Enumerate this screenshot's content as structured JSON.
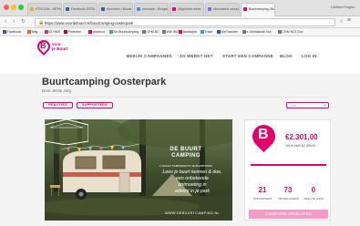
{
  "browser": {
    "tabs": [
      {
        "label": "STROOM - NETW"
      },
      {
        "label": "Facebook ZRTO"
      },
      {
        "label": "Berichten | Brows"
      },
      {
        "label": "armuade - Boogaa"
      },
      {
        "label": "Uitgelichte deze"
      },
      {
        "label": "Nieuwsbrie campa"
      },
      {
        "label": "Buurtcamping, Du"
      }
    ],
    "profile": "Untitled Pages",
    "url": "https://www.voordebuurt.nl/buurtcamping-oosterpark",
    "bookmarks": [
      {
        "label": "Facebook"
      },
      {
        "label": "Bitly"
      },
      {
        "label": "IG HMS"
      },
      {
        "label": "Pinterest"
      },
      {
        "label": "voorinvo"
      },
      {
        "label": "De Buurtcamping"
      },
      {
        "label": "CRM BC"
      },
      {
        "label": "Wie WG"
      },
      {
        "label": "Bankzijde"
      },
      {
        "label": "Trkstr"
      },
      {
        "label": "WeTransfer"
      },
      {
        "label": "e-Verklaarde-Vra"
      },
      {
        "label": "CRM NGI Gov"
      }
    ]
  },
  "site": {
    "logo_line1": "voor",
    "logo_line2": "je Buurt",
    "logo_letter": "B",
    "nav": [
      {
        "label": "BEKIJK CAMPAGNES"
      },
      {
        "label": "ZO WERKT HET"
      },
      {
        "label": "START EEN CAMPAGNE"
      },
      {
        "label": "BLOG"
      },
      {
        "label": "LOG IN"
      }
    ]
  },
  "campaign": {
    "title": "Buurtcamping Oosterpark",
    "byline": "Door Jesse Jorg",
    "reactions_label": "REACTIES",
    "supporters_label": "SUPPORTERS",
    "search_placeholder": "Zoek",
    "image": {
      "badge_top": "DE BUURT",
      "badge_bottom": "CAMPING",
      "badge_sub": "1 NACHT KAMPEREN IN JE BUURTPARK",
      "tagline_lines": [
        "Lees je buurt kennen & doe,",
        "een onbekende",
        "ontmoeting in",
        "advent in je park"
      ],
      "url": "WWW.DEBUURTCAMPING.NL"
    },
    "amount": "€2.301,00",
    "goal_text": "101% VAN €2.300,00",
    "progress_percent": 100,
    "stats": [
      {
        "value": "21",
        "label": "SUPPORTERS"
      },
      {
        "value": "73",
        "label": "VRIJWILLIGERS"
      },
      {
        "value": "0",
        "label": "UREN TE GAAN"
      }
    ],
    "status_button": "CAMPAGNE AFGELOPEN",
    "accent_color": "#e5006d"
  }
}
